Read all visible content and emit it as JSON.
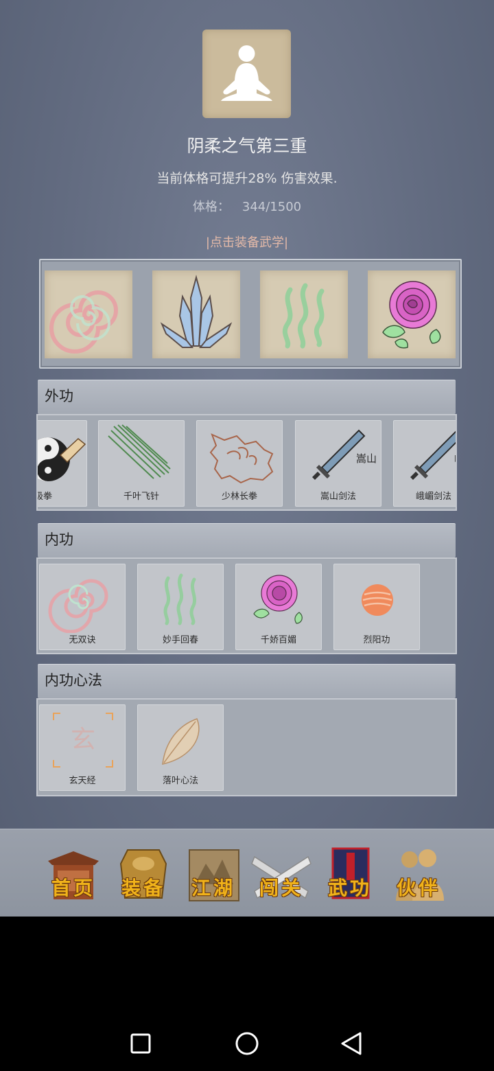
{
  "header": {
    "avatar_icon": "meditation-figure-icon",
    "title": "阴柔之气第三重",
    "description": "当前体格可提升28% 伤害效果.",
    "stat_label": "体格：",
    "stat_value": "344/1500",
    "equip_hint": "|点击装备武学|"
  },
  "equipped": [
    {
      "icon": "spiral-icon"
    },
    {
      "icon": "ice-crystal-icon"
    },
    {
      "icon": "green-waves-icon"
    },
    {
      "icon": "rose-icon"
    }
  ],
  "sections": {
    "waigong": {
      "title": "外功",
      "items": [
        {
          "label": "极拳",
          "icon": "taiji-fist-icon"
        },
        {
          "label": "千叶飞针",
          "icon": "flying-needles-icon"
        },
        {
          "label": "少林长拳",
          "icon": "fist-icon"
        },
        {
          "label": "嵩山剑法",
          "icon": "sword-icon",
          "glyph": "嵩山"
        },
        {
          "label": "峨嵋剑法",
          "icon": "sword-icon",
          "glyph": "峨嵋"
        }
      ]
    },
    "neigong": {
      "title": "内功",
      "items": [
        {
          "label": "无双诀",
          "icon": "spiral-icon"
        },
        {
          "label": "妙手回春",
          "icon": "green-waves-icon"
        },
        {
          "label": "千娇百媚",
          "icon": "rose-icon"
        },
        {
          "label": "烈阳功",
          "icon": "sun-icon"
        }
      ]
    },
    "xinfa": {
      "title": "内功心法",
      "items": [
        {
          "label": "玄天经",
          "icon": "xuan-seal-icon",
          "glyph": "玄"
        },
        {
          "label": "落叶心法",
          "icon": "leaf-icon"
        }
      ]
    }
  },
  "tabs": [
    {
      "label": "首页",
      "icon": "pavilion-icon"
    },
    {
      "label": "装备",
      "icon": "armor-icon"
    },
    {
      "label": "江湖",
      "icon": "scroll-map-icon"
    },
    {
      "label": "闯关",
      "icon": "crossed-swords-icon"
    },
    {
      "label": "武功",
      "icon": "martial-book-icon"
    },
    {
      "label": "伙伴",
      "icon": "partners-icon"
    }
  ],
  "system_nav": [
    {
      "icon": "recent-apps-icon"
    },
    {
      "icon": "home-circle-icon"
    },
    {
      "icon": "back-triangle-icon"
    }
  ]
}
